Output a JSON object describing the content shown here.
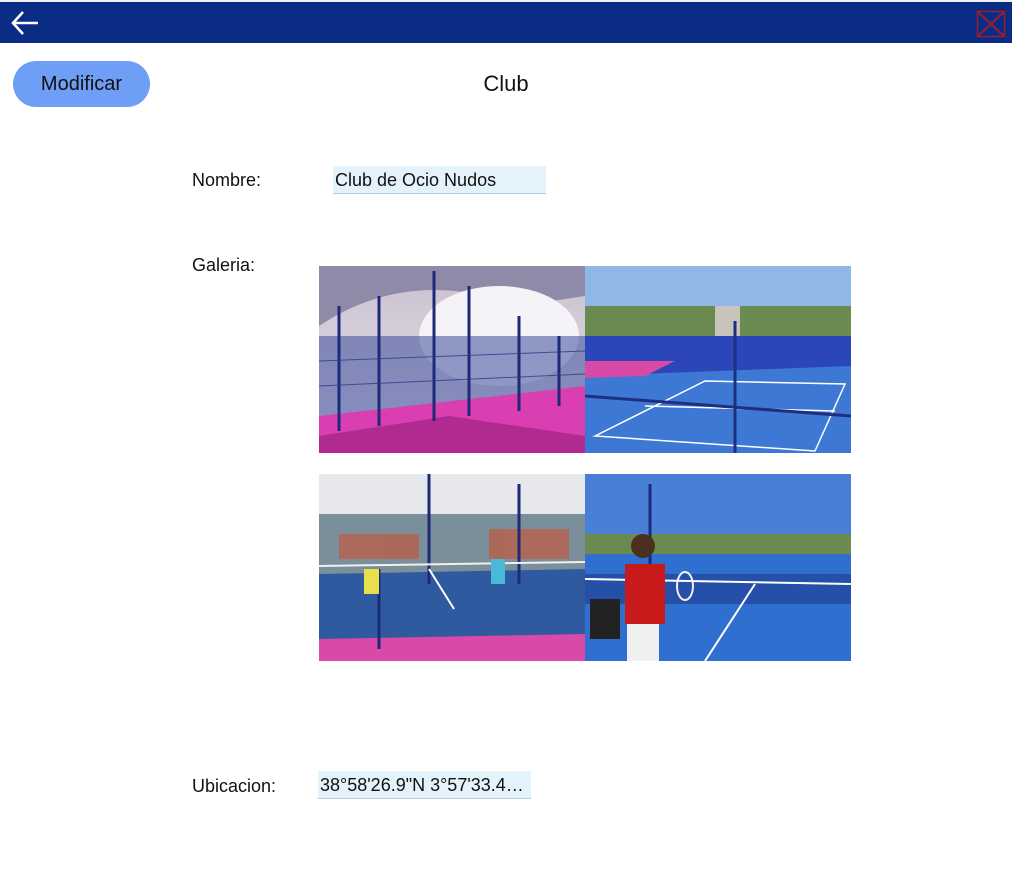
{
  "header": {
    "back_icon": "arrow-left-icon",
    "close_icon": "close-x-icon",
    "background": "#0b2c84"
  },
  "toolbar": {
    "modify_label": "Modificar",
    "modify_color": "#6e9ef5"
  },
  "page": {
    "title": "Club"
  },
  "form": {
    "name_label": "Nombre:",
    "name_value": "Club de Ocio Nudos",
    "gallery_label": "Galeria:",
    "location_label": "Ubicacion:",
    "location_value": "38°58'26.9\"N 3°57'33.4…"
  },
  "gallery": {
    "images": [
      "indoor-padel-courts-photo",
      "outdoor-padel-courts-photo",
      "padel-match-indoor-photo",
      "tennis-player-court-photo"
    ]
  }
}
